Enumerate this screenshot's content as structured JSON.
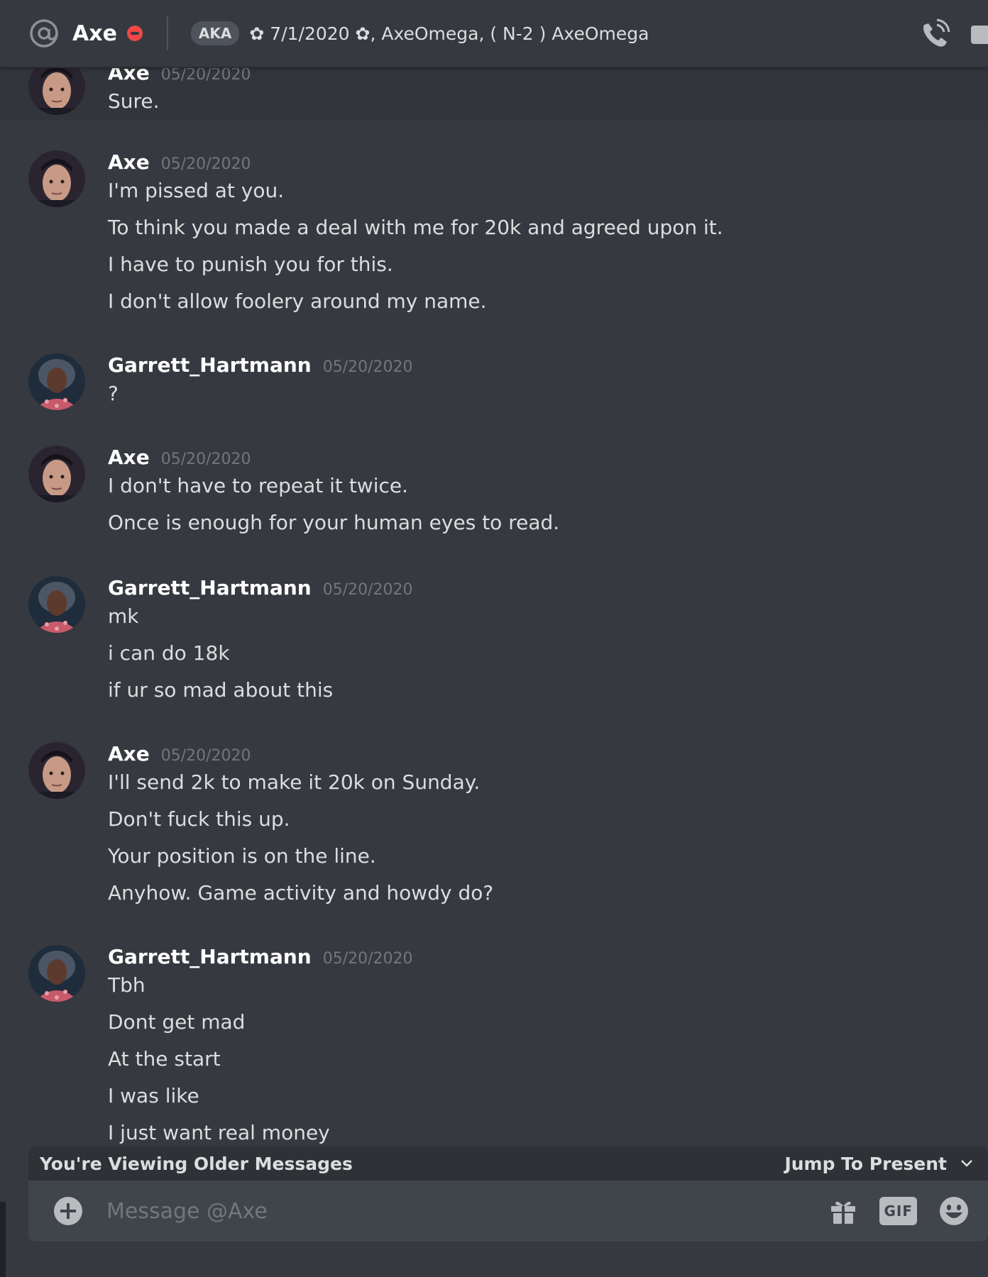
{
  "header": {
    "name": "Axe",
    "aka_label": "AKA",
    "nicknames": "✿ 7/1/2020 ✿, AxeOmega, ( N-2 ) AxeOmega",
    "status_color": "#f04747"
  },
  "messages": [
    {
      "author": "Axe",
      "timestamp": "05/20/2020",
      "lines": [
        "Sure."
      ]
    },
    {
      "author": "Axe",
      "timestamp": "05/20/2020",
      "lines": [
        "I'm pissed at you.",
        "To think you made a deal with me for 20k and agreed upon it.",
        "I have to punish you for this.",
        "I don't allow foolery around my name."
      ]
    },
    {
      "author": "Garrett_Hartmann",
      "timestamp": "05/20/2020",
      "lines": [
        "?"
      ]
    },
    {
      "author": "Axe",
      "timestamp": "05/20/2020",
      "lines": [
        "I don't have to repeat it twice.",
        "Once is enough for your human eyes to read."
      ]
    },
    {
      "author": "Garrett_Hartmann",
      "timestamp": "05/20/2020",
      "lines": [
        "mk",
        "i can do 18k",
        "if ur so mad about this"
      ]
    },
    {
      "author": "Axe",
      "timestamp": "05/20/2020",
      "lines": [
        "I'll send 2k to make it 20k on Sunday.",
        "Don't fuck this up.",
        "Your position is on the line.",
        "Anyhow. Game activity and howdy do?"
      ]
    },
    {
      "author": "Garrett_Hartmann",
      "timestamp": "05/20/2020",
      "lines": [
        "Tbh",
        "Dont get mad",
        "At the start",
        "I was like",
        "I just want real money"
      ]
    }
  ],
  "older_bar": {
    "text": "You're Viewing Older Messages",
    "jump_label": "Jump To Present"
  },
  "composer": {
    "placeholder": "Message @Axe",
    "gif_label": "GIF"
  },
  "icons": {
    "header_left": "at-icon",
    "call": "phone-call-icon",
    "video": "video-camera-icon",
    "attach": "plus-circle-icon",
    "gift": "gift-icon",
    "emoji": "smiley-icon",
    "jump": "chevron-down-icon"
  }
}
